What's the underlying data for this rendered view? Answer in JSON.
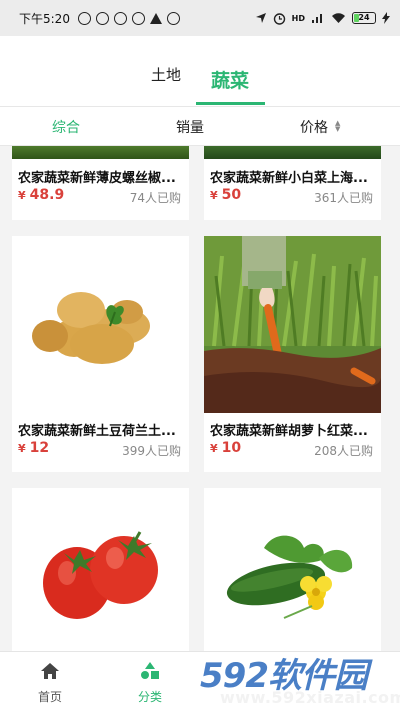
{
  "status_bar": {
    "time": "下午5:20",
    "signal_label": "HD",
    "battery": "24",
    "battery_level": 0.24
  },
  "header": {
    "tabs": [
      {
        "label": "土地",
        "active": false
      },
      {
        "label": "蔬菜",
        "active": true
      }
    ]
  },
  "sort_bar": {
    "options": [
      {
        "label": "综合",
        "active": true
      },
      {
        "label": "销量",
        "active": false
      },
      {
        "label": "价格",
        "active": false
      }
    ],
    "sort_indicator": "▲▼"
  },
  "products": [
    {
      "title": "农家蔬菜新鲜薄皮螺丝椒...",
      "currency": "¥",
      "price": "48.9",
      "sold": "74人已购"
    },
    {
      "title": "农家蔬菜新鲜小白菜上海...",
      "currency": "¥",
      "price": "50",
      "sold": "361人已购"
    },
    {
      "title": "农家蔬菜新鲜土豆荷兰土...",
      "currency": "¥",
      "price": "12",
      "sold": "399人已购"
    },
    {
      "title": "农家蔬菜新鲜胡萝卜红菜...",
      "currency": "¥",
      "price": "10",
      "sold": "208人已购"
    },
    {
      "title": "",
      "currency": "",
      "price": "",
      "sold": ""
    },
    {
      "title": "",
      "currency": "",
      "price": "",
      "sold": ""
    }
  ],
  "bottom_nav": {
    "items": [
      {
        "label": "首页",
        "icon": "home-icon",
        "active": false
      },
      {
        "label": "分类",
        "icon": "category-icon",
        "active": true
      }
    ]
  },
  "watermark": {
    "main": "592软件园",
    "sub": "www.592xiazai.com"
  },
  "colors": {
    "accent": "#2bb673",
    "price": "#d9413b",
    "watermark": "#4a7fc6"
  }
}
